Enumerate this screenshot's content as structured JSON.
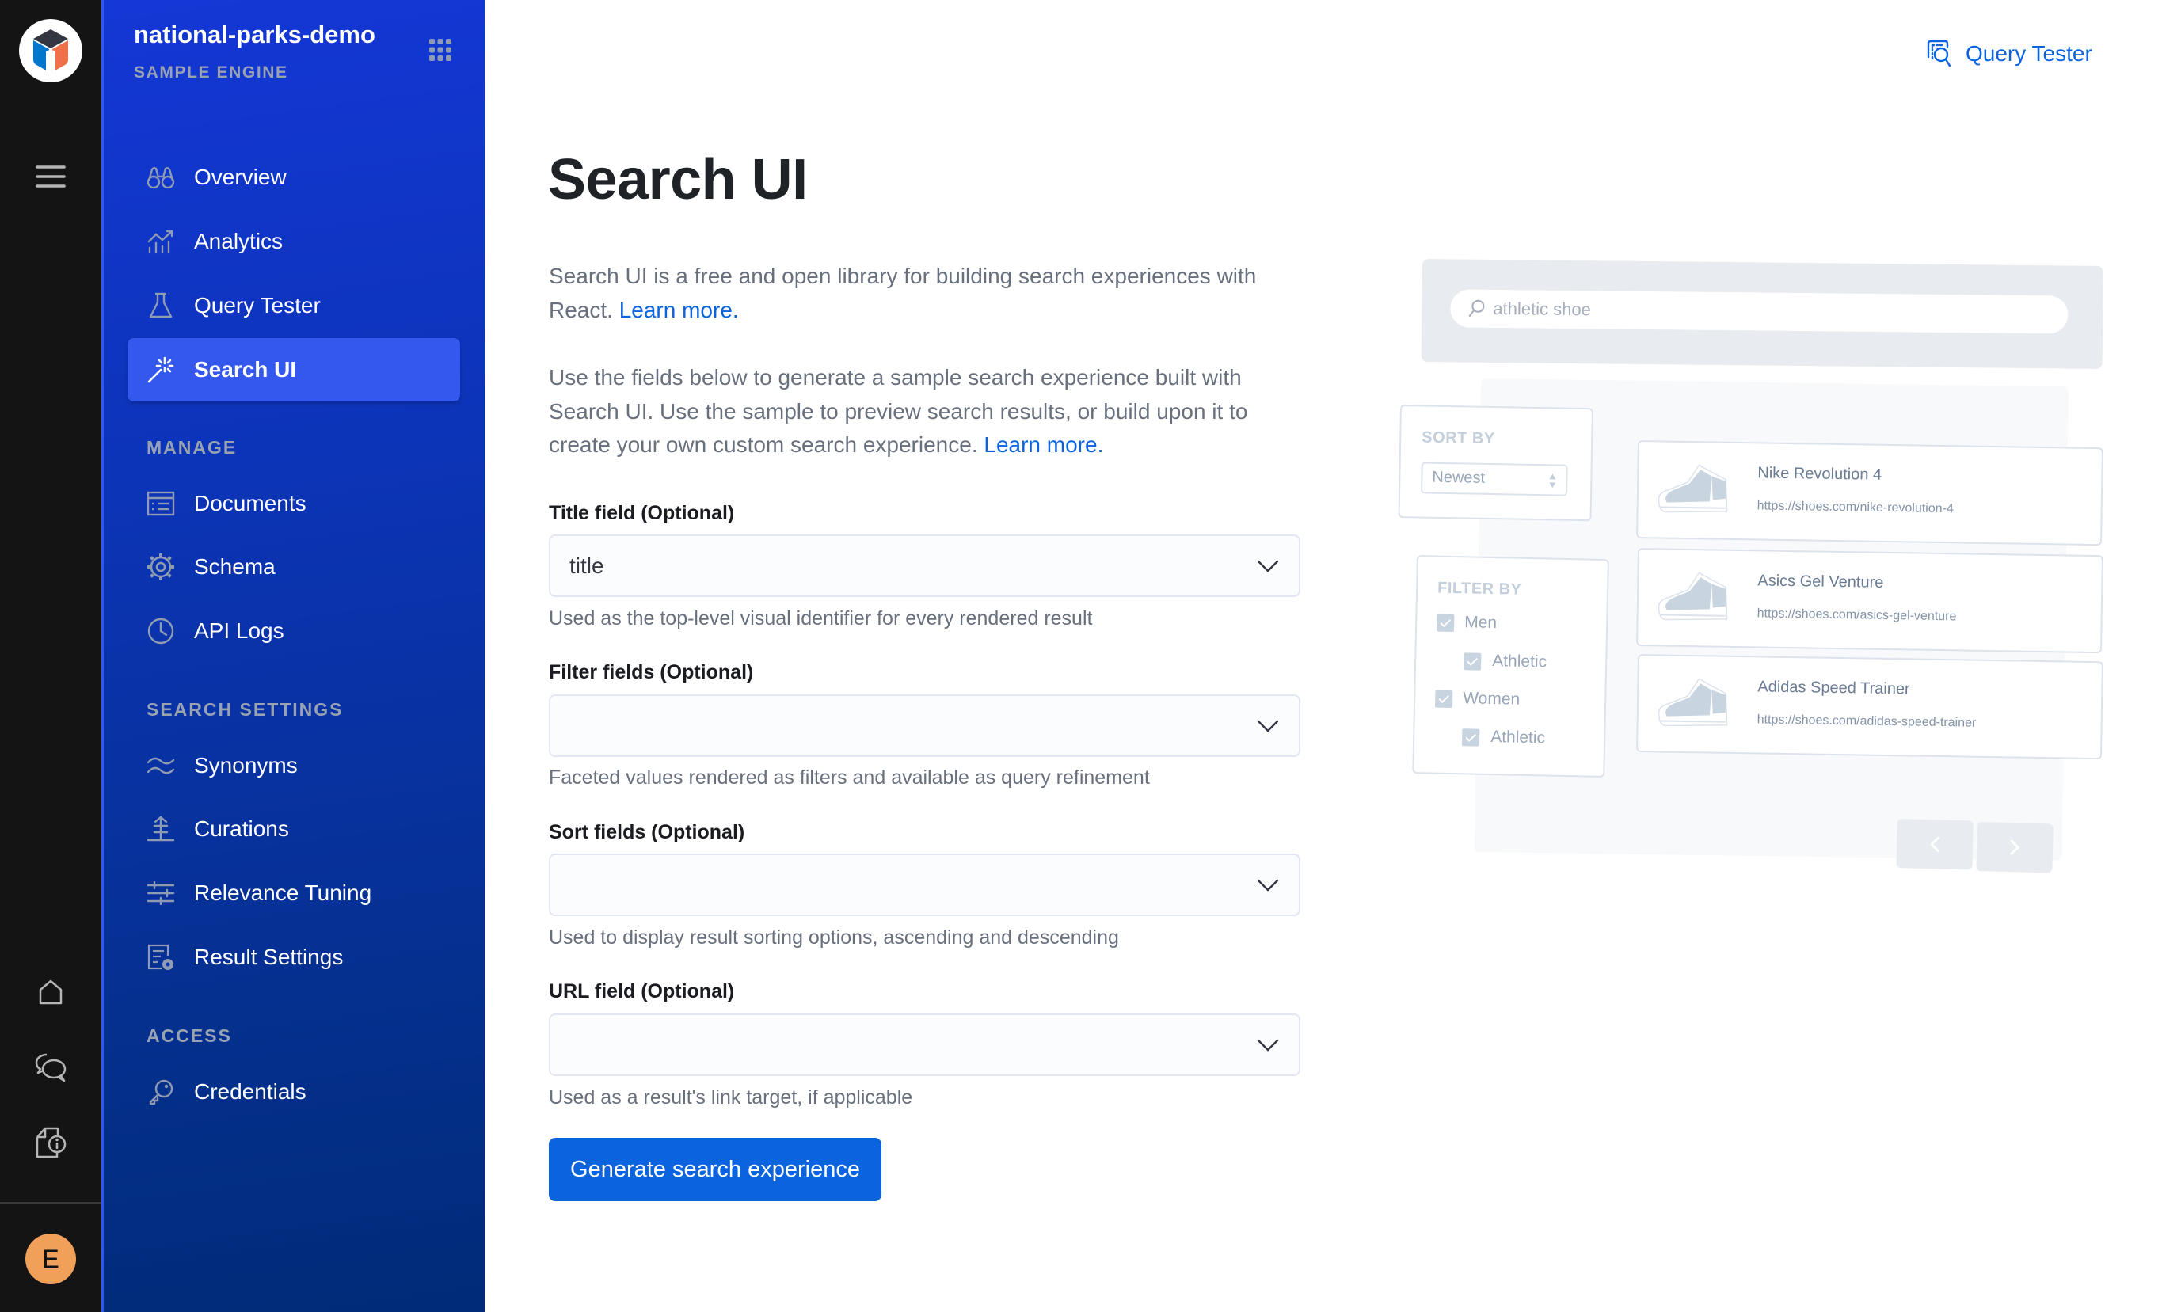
{
  "rail": {
    "logo_icon": "app-search-logo-icon",
    "menu_icon": "hamburger-menu-icon",
    "bottom_icons": [
      "home-icon",
      "chat-bubbles-icon",
      "document-info-icon"
    ],
    "avatar_initial": "E",
    "avatar_color": "#f1a05a"
  },
  "sidebar": {
    "engine_name": "national-parks-demo",
    "engine_subtitle": "SAMPLE ENGINE",
    "apps_icon": "apps-grid-icon",
    "sections": [
      {
        "heading": "",
        "items": [
          {
            "label": "Overview",
            "icon": "binoculars-icon",
            "active": false
          },
          {
            "label": "Analytics",
            "icon": "analytics-chart-icon",
            "active": false
          },
          {
            "label": "Query Tester",
            "icon": "flask-icon",
            "active": false
          },
          {
            "label": "Search UI",
            "icon": "magic-wand-icon",
            "active": true
          }
        ]
      },
      {
        "heading": "MANAGE",
        "items": [
          {
            "label": "Documents",
            "icon": "document-list-icon",
            "active": false
          },
          {
            "label": "Schema",
            "icon": "gear-icon",
            "active": false
          },
          {
            "label": "API Logs",
            "icon": "clock-icon",
            "active": false
          }
        ]
      },
      {
        "heading": "SEARCH SETTINGS",
        "items": [
          {
            "label": "Synonyms",
            "icon": "wave-icon",
            "active": false
          },
          {
            "label": "Curations",
            "icon": "curation-arrow-icon",
            "active": false
          },
          {
            "label": "Relevance Tuning",
            "icon": "sliders-icon",
            "active": false
          },
          {
            "label": "Result Settings",
            "icon": "result-settings-icon",
            "active": false
          }
        ]
      },
      {
        "heading": "ACCESS",
        "items": [
          {
            "label": "Credentials",
            "icon": "key-icon",
            "active": false
          }
        ]
      }
    ],
    "active_color": "#3458ee"
  },
  "header": {
    "query_tester_link": "Query Tester",
    "query_tester_icon": "query-tester-icon"
  },
  "main": {
    "title": "Search UI",
    "intro": {
      "text": "Search UI is a free and open library for building search experiences with React.",
      "link": "Learn more."
    },
    "instructions": {
      "text": "Use the fields below to generate a sample search experience built with Search UI. Use the sample to preview search results, or build upon it to create your own custom search experience.",
      "link": "Learn more."
    },
    "fields": [
      {
        "label": "Title field (Optional)",
        "value": "title",
        "help": "Used as the top-level visual identifier for every rendered result"
      },
      {
        "label": "Filter fields (Optional)",
        "value": "",
        "help": "Faceted values rendered as filters and available as query refinement"
      },
      {
        "label": "Sort fields (Optional)",
        "value": "",
        "help": "Used to display result sorting options, ascending and descending"
      },
      {
        "label": "URL field (Optional)",
        "value": "",
        "help": "Used as a result's link target, if applicable"
      }
    ],
    "generate_button": "Generate search experience",
    "accent_color": "#0b64dd"
  },
  "illustration": {
    "search_query": "athletic shoe",
    "sort": {
      "heading": "SORT BY",
      "selected": "Newest"
    },
    "filter": {
      "heading": "FILTER BY",
      "options": [
        {
          "label": "Men",
          "checked": true,
          "level": 0
        },
        {
          "label": "Athletic",
          "checked": true,
          "level": 1
        },
        {
          "label": "Women",
          "checked": true,
          "level": 0
        },
        {
          "label": "Athletic",
          "checked": true,
          "level": 1
        }
      ]
    },
    "results": [
      {
        "title": "Nike Revolution 4",
        "url": "https://shoes.com/nike-revolution-4"
      },
      {
        "title": "Asics Gel Venture",
        "url": "https://shoes.com/asics-gel-venture"
      },
      {
        "title": "Adidas Speed Trainer",
        "url": "https://shoes.com/adidas-speed-trainer"
      }
    ],
    "pagination": {
      "prev_icon": "chevron-left-icon",
      "next_icon": "chevron-right-icon"
    }
  }
}
